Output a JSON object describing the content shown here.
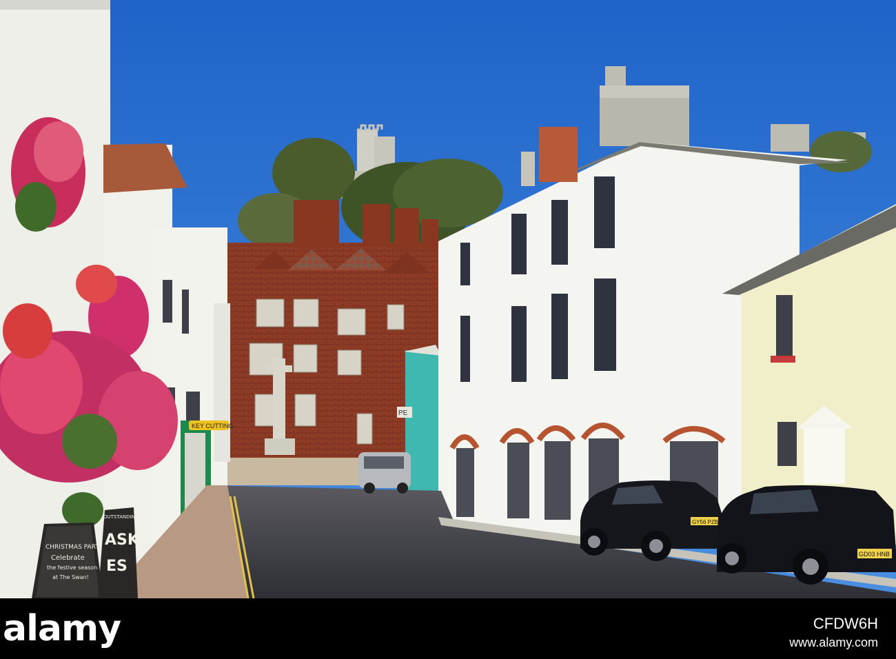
{
  "photo": {
    "palette": {
      "sky": "#2a6fce",
      "brick": "#8e3b26",
      "white_render": "#f4f4f0",
      "cream_house": "#f1efc9",
      "road": "#3c3c42",
      "flowers": "#d42a6a"
    },
    "signs": {
      "chalkboard_left": {
        "line1": "CHRISTMAS PARTY??",
        "line2": "Celebrate",
        "line3": "the festive season",
        "line4": "at The Swan!"
      },
      "chalkboard_right": {
        "top": "OUTSTANDING",
        "word1": "ASK",
        "word2": "ES"
      },
      "shop_sign": "KEY CUTTING",
      "plate_left_car": "GY56 PZB",
      "plate_right_car": "GD03 HNB",
      "shop_fascia_partial": "PE"
    }
  },
  "footer": {
    "logo_text": "alamy",
    "image_id": "CFDW6H",
    "caption": "www.alamy.com"
  }
}
